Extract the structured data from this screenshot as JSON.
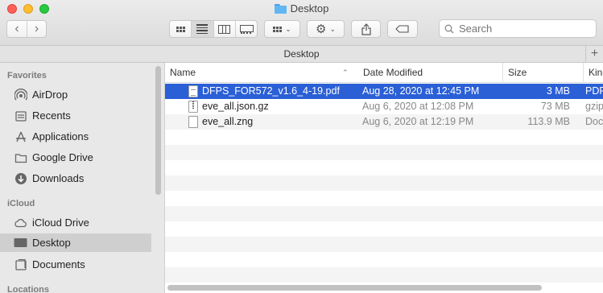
{
  "window": {
    "title": "Desktop"
  },
  "toolbar": {
    "back_icon": "chevron-left-icon",
    "forward_icon": "chevron-right-icon",
    "views": [
      "icon-view",
      "list-view",
      "column-view",
      "gallery-view"
    ],
    "active_view": "list-view",
    "search_placeholder": "Search"
  },
  "pathbar": {
    "label": "Desktop",
    "plus": "+"
  },
  "sidebar": {
    "sections": [
      {
        "title": "Favorites",
        "items": [
          {
            "label": "AirDrop",
            "icon": "airdrop-icon"
          },
          {
            "label": "Recents",
            "icon": "recents-icon"
          },
          {
            "label": "Applications",
            "icon": "applications-icon"
          },
          {
            "label": "Google Drive",
            "icon": "folder-icon"
          },
          {
            "label": "Downloads",
            "icon": "downloads-icon"
          }
        ]
      },
      {
        "title": "iCloud",
        "items": [
          {
            "label": "iCloud Drive",
            "icon": "cloud-icon"
          },
          {
            "label": "Desktop",
            "icon": "desktop-icon",
            "selected": true
          },
          {
            "label": "Documents",
            "icon": "document-icon"
          }
        ]
      },
      {
        "title": "Locations",
        "items": []
      }
    ]
  },
  "columns": {
    "name": "Name",
    "date": "Date Modified",
    "size": "Size",
    "kind": "Kind"
  },
  "files": [
    {
      "name": "DFPS_FOR572_v1.6_4-19.pdf",
      "date": "Aug 28, 2020 at 12:45 PM",
      "size": "3 MB",
      "kind": "PDF",
      "selected": true
    },
    {
      "name": "eve_all.json.gz",
      "date": "Aug 6, 2020 at 12:08 PM",
      "size": "73 MB",
      "kind": "gzip"
    },
    {
      "name": "eve_all.zng",
      "date": "Aug 6, 2020 at 12:19 PM",
      "size": "113.9 MB",
      "kind": "Doc"
    }
  ],
  "colors": {
    "selection": "#2a5fd6",
    "sidebar_bg": "#e9e8e9"
  }
}
